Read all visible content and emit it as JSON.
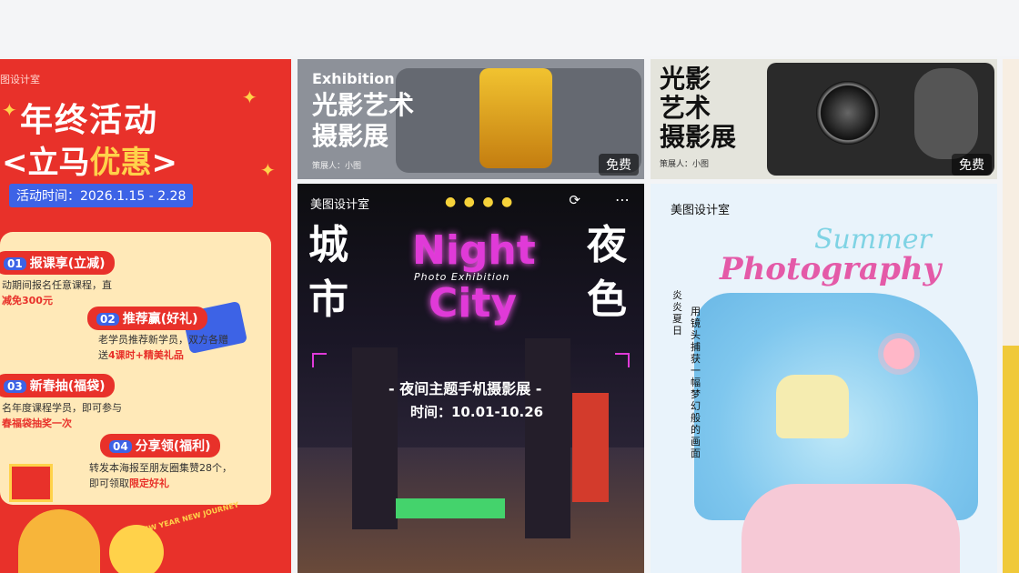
{
  "cards": {
    "red_poster": {
      "brand": "图设计室",
      "title_line1": "年终活动",
      "title_line2_a": "<立马",
      "title_line2_b": "优惠",
      "title_line2_c": ">",
      "activity_time": "活动时间：2026.1.15 - 2.28",
      "items": [
        {
          "num": "01",
          "title": "报课享(立减)",
          "desc1": "动期间报名任意课程，直",
          "desc2": "减免300元"
        },
        {
          "num": "02",
          "title": "推荐赢(好礼)",
          "desc1": "老学员推荐新学员，双方各赠",
          "desc2a": "送",
          "desc2b": "4课时+精美礼品"
        },
        {
          "num": "03",
          "title": "新春抽(福袋)",
          "desc1": "名年度课程学员，即可参与",
          "desc2": "春福袋抽奖一次"
        },
        {
          "num": "04",
          "title": "分享领(福利)",
          "desc1": "转发本海报至朋友圈集赞28个，",
          "desc2a": "即可领取",
          "desc2b": "限定好礼"
        }
      ],
      "new_year": "NEW YEAR NEW JOURNEY",
      "colors": {
        "bg": "#e8312a",
        "accent": "#ffd24a",
        "blue": "#3d63e6"
      }
    },
    "exhibition_light": {
      "tag": "Exhibition",
      "title_line1": "光影艺术",
      "title_line2": "摄影展",
      "curator": "策展人：小图",
      "badge": "免费"
    },
    "exhibition_camera": {
      "title_line1": "光影",
      "title_line2": "艺术",
      "title_line3": "摄影展",
      "curator": "策展人：小图",
      "badge": "免费"
    },
    "night_city": {
      "brand": "美图设计室",
      "dots": "● ● ● ●",
      "refresh_icon": "refresh-icon",
      "menu_icon": "more-icon",
      "left_chars": "城市",
      "right_chars": "夜色",
      "night": "Night",
      "city": "City",
      "photo_exhibition": "Photo  Exhibition",
      "subtitle": "- 夜间主题手机摄影展 -",
      "date": "时间：10.01-10.26"
    },
    "summer": {
      "brand": "美图设计室",
      "summer": "Summer",
      "photography": "Photography",
      "vertical1": "炎炎夏日",
      "vertical2": "用镜头捕获一幅梦幻般的画面"
    }
  }
}
